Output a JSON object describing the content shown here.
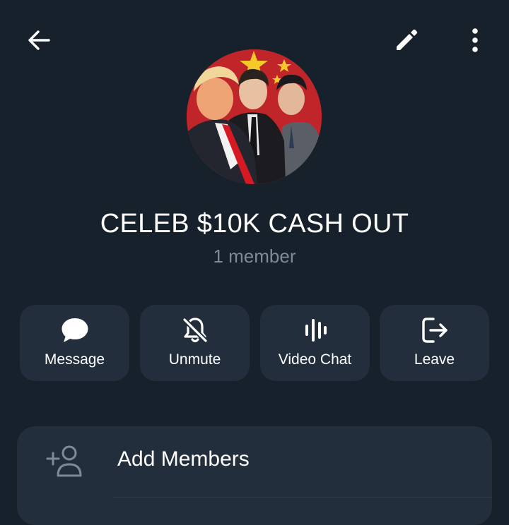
{
  "header": {
    "back_icon": "arrow-left-icon",
    "edit_icon": "pencil-icon",
    "more_icon": "more-vertical-icon"
  },
  "group": {
    "title": "CELEB $10K CASH OUT",
    "member_count": "1 member"
  },
  "actions": [
    {
      "label": "Message",
      "icon": "chat-bubble-icon"
    },
    {
      "label": "Unmute",
      "icon": "bell-off-icon"
    },
    {
      "label": "Video Chat",
      "icon": "voice-wave-icon"
    },
    {
      "label": "Leave",
      "icon": "logout-icon"
    }
  ],
  "menu": {
    "add_members": "Add Members"
  },
  "colors": {
    "background": "#17212b",
    "button_bg": "#232e3c",
    "muted_text": "#7d8b99"
  }
}
